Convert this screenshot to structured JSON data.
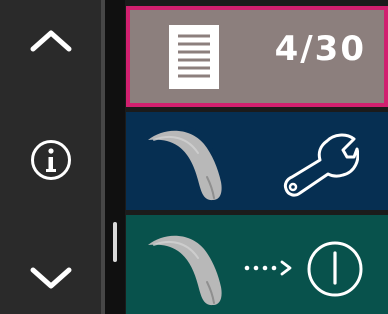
{
  "navigation": {
    "up_icon": "chevron-up-icon",
    "info_icon": "info-icon",
    "down_icon": "chevron-down-icon"
  },
  "cards": {
    "count": {
      "text": "4/30",
      "icon": "document-icon"
    },
    "service": {
      "icon_left": "handpiece-icon",
      "icon_right": "wrench-icon"
    },
    "power": {
      "icon_left": "handpiece-icon",
      "icon_mid": "dots-arrow-icon",
      "icon_right": "power-icon"
    }
  },
  "colors": {
    "left_panel": "#2a2a2a",
    "count_tile": "#8c7f7d",
    "count_border": "#d1206f",
    "service_tile": "#062f52",
    "power_tile": "#08524c",
    "icon_light": "#ffffff",
    "handpiece_gray": "#b8b8b8"
  }
}
